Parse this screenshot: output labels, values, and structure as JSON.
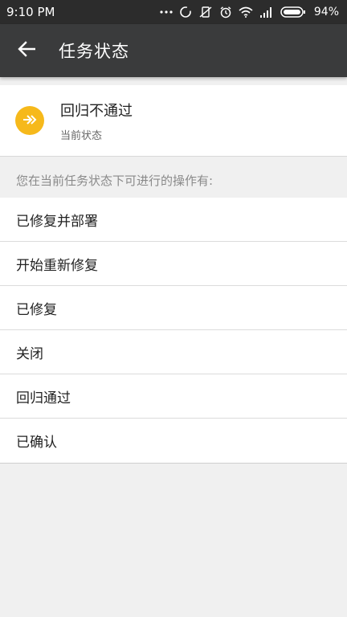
{
  "status_bar": {
    "time": "9:10 PM",
    "battery": "94%",
    "icons": [
      "more-dots-icon",
      "sync-icon",
      "vibrate-off-icon",
      "alarm-icon",
      "wifi-icon",
      "signal-icon",
      "battery-icon"
    ]
  },
  "app_bar": {
    "title": "任务状态",
    "back_icon": "arrow-left-icon"
  },
  "current_state": {
    "title": "回归不通过",
    "subtitle": "当前状态",
    "icon": "double-arrow-right-icon",
    "icon_color": "#f6b91b"
  },
  "actions": {
    "hint": "您在当前任务状态下可进行的操作有:",
    "items": [
      {
        "label": "已修复并部署"
      },
      {
        "label": "开始重新修复"
      },
      {
        "label": "已修复"
      },
      {
        "label": "关闭"
      },
      {
        "label": "回归通过"
      },
      {
        "label": "已确认"
      }
    ]
  }
}
